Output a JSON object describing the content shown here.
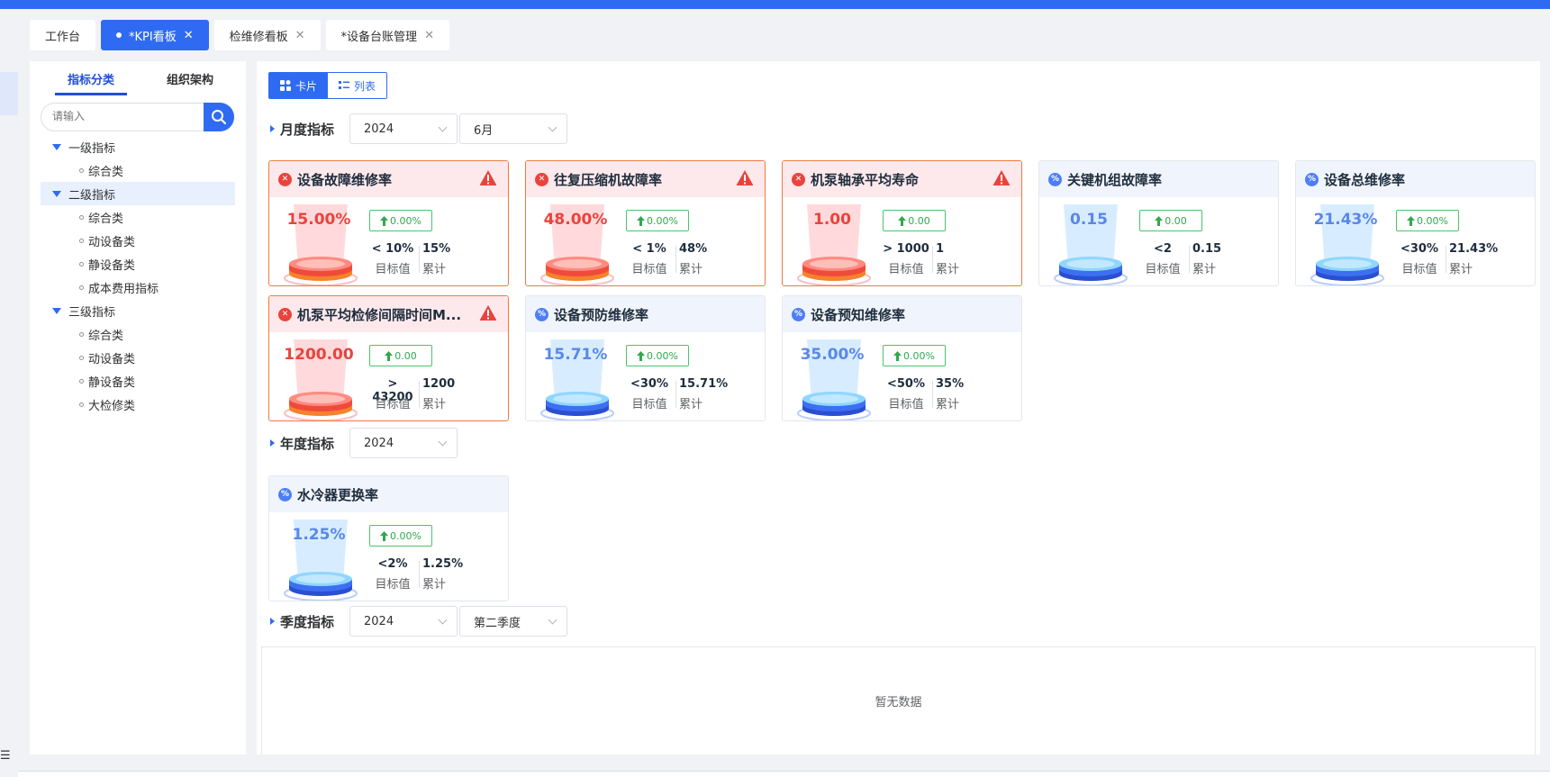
{
  "tabs": [
    {
      "label": "工作台",
      "active": false,
      "closable": false
    },
    {
      "label": "*KPI看板",
      "active": true,
      "closable": true
    },
    {
      "label": "检维修看板",
      "active": false,
      "closable": true
    },
    {
      "label": "*设备台账管理",
      "active": false,
      "closable": true
    }
  ],
  "sidebar": {
    "tabs": [
      "指标分类",
      "组织架构"
    ],
    "search_placeholder": "请输入",
    "tree": [
      {
        "label": "一级指标",
        "level": 1
      },
      {
        "label": "综合类",
        "level": 2
      },
      {
        "label": "二级指标",
        "level": 1,
        "highlighted": true
      },
      {
        "label": "综合类",
        "level": 2
      },
      {
        "label": "动设备类",
        "level": 2
      },
      {
        "label": "静设备类",
        "level": 2
      },
      {
        "label": "成本费用指标",
        "level": 2
      },
      {
        "label": "三级指标",
        "level": 1
      },
      {
        "label": "综合类",
        "level": 2
      },
      {
        "label": "动设备类",
        "level": 2
      },
      {
        "label": "静设备类",
        "level": 2
      },
      {
        "label": "大检修类",
        "level": 2
      }
    ]
  },
  "view_toggle": {
    "card": "卡片",
    "list": "列表"
  },
  "monthly": {
    "title": "月度指标",
    "year": "2024",
    "month": "6月",
    "cards": [
      {
        "title": "设备故障维修率",
        "alert": true,
        "value": "15.00%",
        "change": "0.00%",
        "target": "< 10%",
        "accum": "15%"
      },
      {
        "title": "往复压缩机故障率",
        "alert": true,
        "value": "48.00%",
        "change": "0.00%",
        "target": "< 1%",
        "accum": "48%"
      },
      {
        "title": "机泵轴承平均寿命",
        "alert": true,
        "value": "1.00",
        "change": "0.00",
        "target": "> 1000",
        "accum": "1"
      },
      {
        "title": "关键机组故障率",
        "alert": false,
        "value": "0.15",
        "change": "0.00",
        "target": "<2",
        "accum": "0.15"
      },
      {
        "title": "设备总维修率",
        "alert": false,
        "value": "21.43%",
        "change": "0.00%",
        "target": "<30%",
        "accum": "21.43%"
      },
      {
        "title": "机泵平均检修间隔时间M...",
        "alert": true,
        "value": "1200.00",
        "change": "0.00",
        "target": "> 43200",
        "accum": "1200"
      },
      {
        "title": "设备预防维修率",
        "alert": false,
        "value": "15.71%",
        "change": "0.00%",
        "target": "<30%",
        "accum": "15.71%"
      },
      {
        "title": "设备预知维修率",
        "alert": false,
        "value": "35.00%",
        "change": "0.00%",
        "target": "<50%",
        "accum": "35%"
      }
    ]
  },
  "yearly": {
    "title": "年度指标",
    "year": "2024",
    "cards": [
      {
        "title": "水冷器更换率",
        "alert": false,
        "value": "1.25%",
        "change": "0.00%",
        "target": "<2%",
        "accum": "1.25%"
      }
    ]
  },
  "quarterly": {
    "title": "季度指标",
    "year": "2024",
    "quarter": "第二季度",
    "empty_text": "暂无数据"
  },
  "labels": {
    "target": "目标值",
    "accum": "累计"
  },
  "colors": {
    "primary": "#2f6bf2",
    "alert": "#e8443c",
    "ok_value": "#5a87e8",
    "change": "#2fa84f"
  },
  "icons": {
    "alert_badge": "x-circle-icon",
    "normal_badge": "percent-circle-icon",
    "warning": "exclamation-triangle-icon",
    "change": "arrow-up-icon",
    "search": "search-icon"
  }
}
